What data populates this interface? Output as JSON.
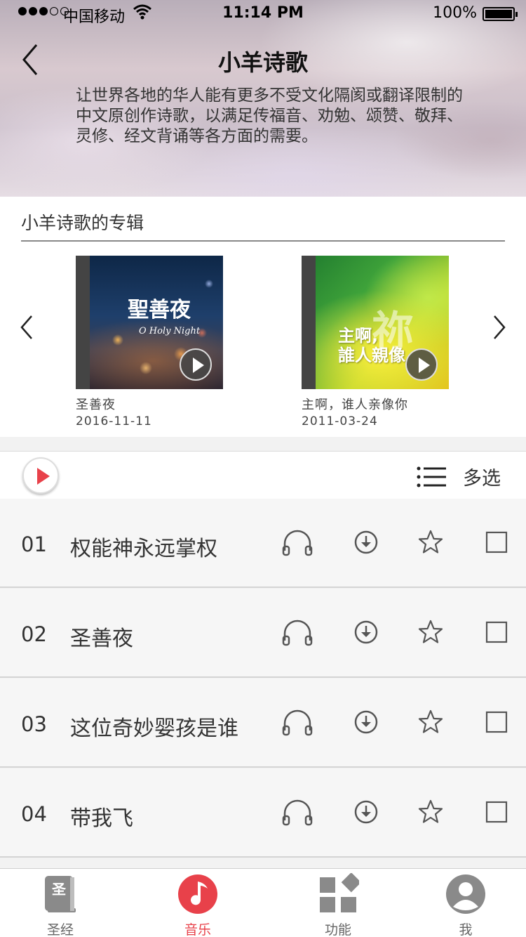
{
  "status_bar": {
    "carrier": "中国移动",
    "time": "11:14 PM",
    "battery": "100%",
    "signal_bars": 3,
    "signal_total": 5
  },
  "header": {
    "title": "小羊诗歌",
    "description": "让世界各地的华人能有更多不受文化隔阂或翻译限制的中文原创作诗歌，以满足传福音、劝勉、颂赞、敬拜、灵修、经文背诵等各方面的需要。"
  },
  "albums": {
    "section_title": "小羊诗歌的专辑",
    "items": [
      {
        "name": "圣善夜",
        "date": "2016-11-11",
        "cover_title": "聖善夜",
        "cover_subtitle": "O Holy Night"
      },
      {
        "name": "主啊，谁人亲像你",
        "date": "2011-03-24",
        "cover_title": "主啊,\n誰人親像",
        "cover_watermark": "祢"
      }
    ]
  },
  "toolbar": {
    "multi_select_label": "多选"
  },
  "tracks": [
    {
      "number": "01",
      "title": "权能神永远掌权"
    },
    {
      "number": "02",
      "title": "圣善夜"
    },
    {
      "number": "03",
      "title": "这位奇妙婴孩是谁"
    },
    {
      "number": "04",
      "title": "带我飞"
    }
  ],
  "tabbar": {
    "items": [
      {
        "label": "圣经",
        "icon": "bible-icon",
        "active": false
      },
      {
        "label": "音乐",
        "icon": "music-icon",
        "active": true
      },
      {
        "label": "功能",
        "icon": "grid-icon",
        "active": false
      },
      {
        "label": "我",
        "icon": "profile-icon",
        "active": false
      }
    ]
  },
  "colors": {
    "accent": "#e8414a"
  }
}
